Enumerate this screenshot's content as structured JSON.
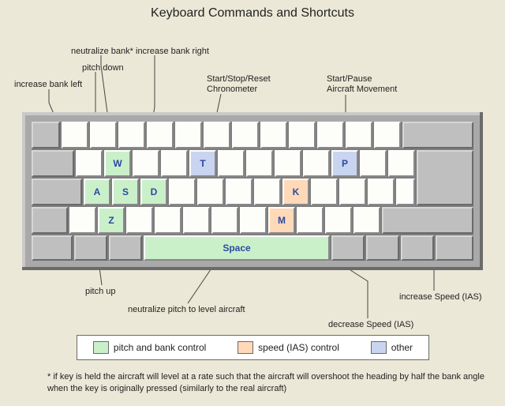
{
  "title": "Keyboard Commands and Shortcuts",
  "keys": {
    "W": "W",
    "A": "A",
    "S": "S",
    "D": "D",
    "T": "T",
    "P": "P",
    "K": "K",
    "M": "M",
    "Z": "Z",
    "Space": "Space"
  },
  "annotations": {
    "increase_bank_left": "increase bank left",
    "neutralize_bank": "neutralize bank*",
    "pitch_down": "pitch down",
    "increase_bank_right": "increase bank right",
    "chronometer_l1": "Start/Stop/Reset",
    "chronometer_l2": "Chronometer",
    "aircraft_mov_l1": "Start/Pause",
    "aircraft_mov_l2": "Aircraft Movement",
    "pitch_up": "pitch up",
    "neutralize_pitch": "neutralize pitch to level aircraft",
    "decrease_speed": "decrease Speed (IAS)",
    "increase_speed": "increase Speed (IAS)"
  },
  "legend": {
    "pitch_bank": "pitch and bank control",
    "speed": "speed (IAS) control",
    "other": "other"
  },
  "footnote": "* if key is held the aircraft will level at a rate such that the aircraft will overshoot the heading by half the bank angle when the key is originally pressed (similarly to the real aircraft)",
  "colors": {
    "green": "#caf0ca",
    "peach": "#ffd9b8",
    "blue": "#c9d4f0"
  }
}
